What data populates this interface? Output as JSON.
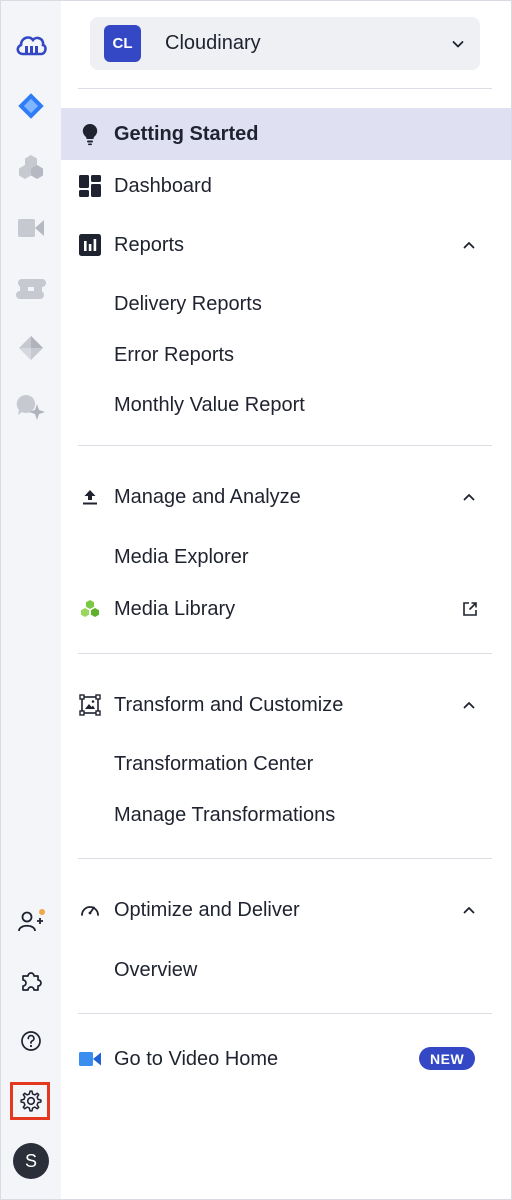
{
  "colors": {
    "accent": "#3448c5",
    "active_bg": "#dfe1f3",
    "rail_bg": "#f4f5f9",
    "settings_highlight": "#e5391f",
    "notification_dot": "#f0a64a"
  },
  "rail": {
    "top_icons": [
      "cloudinary-logo-icon",
      "assets-diamond-icon",
      "hexagons-icon",
      "video-camera-icon",
      "s-shape-icon",
      "cube-icon",
      "chat-sparkle-icon"
    ],
    "bottom_icons": [
      "invite-user-icon",
      "puzzle-icon",
      "help-icon",
      "settings-icon"
    ],
    "avatar_initial": "S"
  },
  "account": {
    "initials": "CL",
    "name": "Cloudinary"
  },
  "nav": {
    "getting_started": "Getting Started",
    "dashboard": "Dashboard",
    "reports": {
      "label": "Reports",
      "items": [
        "Delivery Reports",
        "Error Reports",
        "Monthly Value Report"
      ]
    },
    "manage": {
      "label": "Manage and Analyze",
      "items": [
        "Media Explorer",
        "Media Library"
      ]
    },
    "transform": {
      "label": "Transform and Customize",
      "items": [
        "Transformation Center",
        "Manage Transformations"
      ]
    },
    "optimize": {
      "label": "Optimize and Deliver",
      "items": [
        "Overview"
      ]
    },
    "video_home": {
      "label": "Go to Video Home",
      "badge": "NEW"
    }
  }
}
